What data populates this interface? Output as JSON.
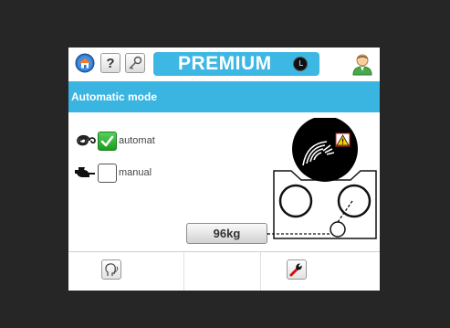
{
  "toolbar": {
    "home_icon": "home-icon",
    "help_label": "?",
    "key_icon": "key-icon",
    "badge_label": "PREMIUM",
    "clock_icon": "clock-icon",
    "user_icon": "user-icon",
    "accent_color": "#3ab4e1"
  },
  "titlebar": {
    "title": "Automatic mode"
  },
  "modes": [
    {
      "label": "automat",
      "icon": "spiral-icon",
      "checked": true
    },
    {
      "label": "manual",
      "icon": "hand-icon",
      "checked": false
    }
  ],
  "diagram": {
    "signal_icon": "signal-icon",
    "warning_icon": "warning-icon"
  },
  "weight": {
    "value": "96kg"
  },
  "bottombar": {
    "left_icon": "head-sound-icon",
    "right_icon": "wrench-icon"
  }
}
